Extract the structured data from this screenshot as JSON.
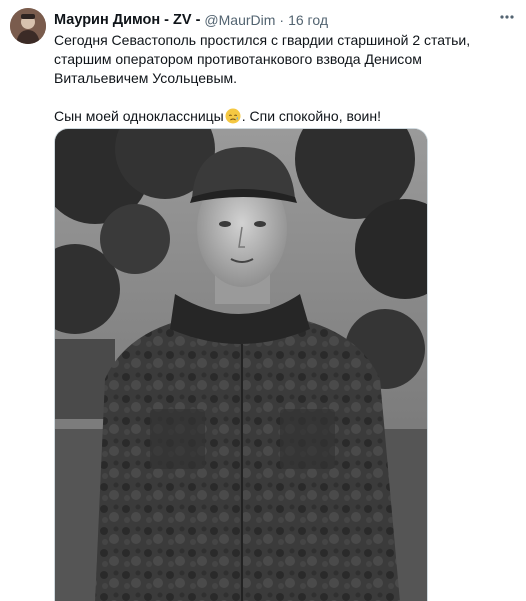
{
  "tweet": {
    "display_name": "Маурин Димон - ZV -",
    "handle": "@MaurDim",
    "separator": "·",
    "time": "16 год",
    "more_icon": "more-dots-icon",
    "text_line_1": "Сегодня Севастополь простился с гвардии старшиной 2 статьи, старшим оператором  противотанкового взвода Денисом Витальевичем Усольцевым.",
    "text_line_2_before": "Сын моей одноклассницы",
    "text_line_2_emoji": "crying-face-emoji",
    "text_line_2_after": ". Спи спокойно, воин!",
    "photo": "black-and-white-portrait-photo"
  }
}
